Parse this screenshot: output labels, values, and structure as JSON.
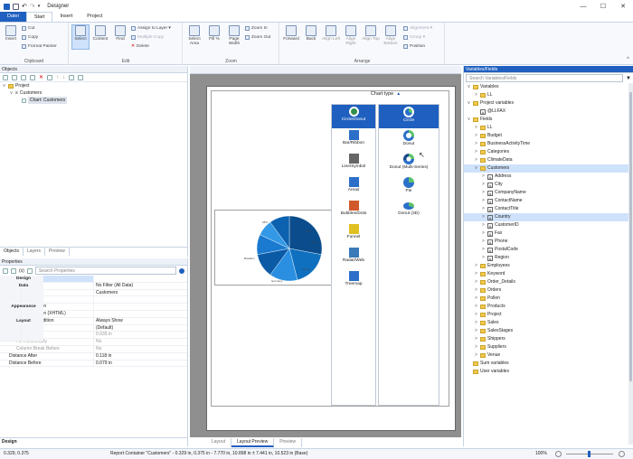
{
  "window": {
    "title": "Designer",
    "minimize": "—",
    "maximize": "☐",
    "close": "✕"
  },
  "tabs": [
    "Datei",
    "Start",
    "Insert",
    "Project"
  ],
  "ribbon": {
    "insert": "Insert",
    "cut": "Cut",
    "copy": "Copy",
    "format_painter": "Format Painter",
    "clipboard_label": "Clipboard",
    "select": "Select",
    "content": "Content",
    "find": "Find",
    "assign_to_layer": "Assign to Layer ▾",
    "multiple_copy": "Multiple Copy",
    "delete": "Delete",
    "edit_label": "Edit",
    "select_area": "Select Area",
    "fill": "Fill %",
    "page_width": "Page Width",
    "zoom_in": "Zoom In",
    "zoom_out": "Zoom Out",
    "zoom_label": "Zoom",
    "forward": "Forward",
    "back": "Back",
    "align_left": "Align Left",
    "align_right": "Align Right",
    "align_top": "Align Top",
    "align_bottom": "Align Bottom",
    "alignment": "Alignment ▾",
    "group": "Group ▾",
    "position": "Position",
    "arrange_label": "Arrange"
  },
  "objects": {
    "header": "Objects",
    "tree": [
      "Project",
      "Customers",
      "Chart: Customers"
    ],
    "tabs": [
      "Objects",
      "Layers",
      "Preview"
    ]
  },
  "properties": {
    "header": "Properties",
    "search_placeholder": "Search Properties",
    "rows": [
      {
        "n": "Design",
        "v": "",
        "k": "cat"
      },
      {
        "n": "Name",
        "v": "",
        "k": "sel"
      },
      {
        "n": "Data",
        "v": "",
        "k": "cat"
      },
      {
        "n": "Data Filter",
        "v": "No Filter (All Data)",
        "k": ""
      },
      {
        "n": "Data Source",
        "v": "Customers",
        "k": ""
      },
      {
        "n": "Sort Order",
        "v": "",
        "k": ""
      },
      {
        "n": "Appearance",
        "v": "",
        "k": "cat"
      },
      {
        "n": "Preview Animation",
        "v": "",
        "k": ""
      },
      {
        "n": "Preview Animation (XHTML)",
        "v": "",
        "k": ""
      },
      {
        "n": "Layout",
        "v": "",
        "k": "cat"
      },
      {
        "n": "Appearance Condition",
        "v": "Always Show",
        "k": ""
      },
      {
        "n": "Column Count",
        "v": "(Default)",
        "k": ""
      },
      {
        "n": "Distance",
        "v": "0.039 in",
        "k": "sub dim"
      },
      {
        "n": "Fill Horizontally",
        "v": "No",
        "k": "sub dim"
      },
      {
        "n": "Column Break Before",
        "v": "No",
        "k": "sub dim"
      },
      {
        "n": "Distance After",
        "v": "0.118 in",
        "k": ""
      },
      {
        "n": "Distance Before",
        "v": "0.079 in",
        "k": ""
      }
    ],
    "footer": "Design"
  },
  "designer": {
    "chart_type_label": "Chart type",
    "categories": [
      "Circle/Donut",
      "Bar/Ribbon",
      "Line/Symbol",
      "Areas",
      "Bubbles/Dots",
      "Funnel",
      "Radar/Web",
      "Treemap"
    ],
    "types": [
      "Circle",
      "Donut",
      "Donut (Multi-Series)",
      "Pie",
      "Donut (3D)"
    ],
    "bottom_tabs": [
      "Layout",
      "Layout Preview",
      "Preview"
    ]
  },
  "pie_labels": [
    "28%",
    "18%",
    "Brasilien",
    "Germany",
    "France",
    "USA"
  ],
  "chart_data": {
    "type": "pie",
    "values": [
      28,
      18,
      14,
      12,
      10,
      8,
      10
    ],
    "colors": [
      "#0a4c8c",
      "#1070c0",
      "#2a8fe0",
      "#0a5aa6",
      "#1a7ad0",
      "#3398e6",
      "#0d62b0"
    ]
  },
  "variables": {
    "header": "Variables/Fields",
    "search_placeholder": "Search Variables/Fields",
    "tree": [
      {
        "t": "Variables",
        "lvl": 0,
        "ic": "fold",
        "ch": "v"
      },
      {
        "t": "LL",
        "lvl": 1,
        "ic": "fold",
        "ch": ">"
      },
      {
        "t": "Project variables",
        "lvl": 0,
        "ic": "fold",
        "ch": "v"
      },
      {
        "t": "@LLFAX",
        "lvl": 1,
        "ic": "af",
        "ch": ""
      },
      {
        "t": "Fields",
        "lvl": 0,
        "ic": "fold",
        "ch": "v"
      },
      {
        "t": "LL",
        "lvl": 1,
        "ic": "fold",
        "ch": ">"
      },
      {
        "t": "Budget",
        "lvl": 1,
        "ic": "fold",
        "ch": ">"
      },
      {
        "t": "BusinessActivityTime",
        "lvl": 1,
        "ic": "fold",
        "ch": ">"
      },
      {
        "t": "Categories",
        "lvl": 1,
        "ic": "fold",
        "ch": ">"
      },
      {
        "t": "ClimateData",
        "lvl": 1,
        "ic": "fold",
        "ch": ">"
      },
      {
        "t": "Customers",
        "lvl": 1,
        "ic": "fold",
        "ch": "v",
        "sel": true
      },
      {
        "t": "Address",
        "lvl": 2,
        "ic": "af",
        "ch": ">"
      },
      {
        "t": "City",
        "lvl": 2,
        "ic": "af",
        "ch": ">"
      },
      {
        "t": "CompanyName",
        "lvl": 2,
        "ic": "af",
        "ch": ">"
      },
      {
        "t": "ContactName",
        "lvl": 2,
        "ic": "af",
        "ch": ">"
      },
      {
        "t": "ContactTitle",
        "lvl": 2,
        "ic": "af",
        "ch": ">"
      },
      {
        "t": "Country",
        "lvl": 2,
        "ic": "af",
        "ch": ">",
        "sel": true
      },
      {
        "t": "CustomerID",
        "lvl": 2,
        "ic": "af",
        "ch": ">"
      },
      {
        "t": "Fax",
        "lvl": 2,
        "ic": "af",
        "ch": ">"
      },
      {
        "t": "Phone",
        "lvl": 2,
        "ic": "af",
        "ch": ">"
      },
      {
        "t": "PostalCode",
        "lvl": 2,
        "ic": "af",
        "ch": ">"
      },
      {
        "t": "Region",
        "lvl": 2,
        "ic": "af",
        "ch": ">"
      },
      {
        "t": "Employees",
        "lvl": 1,
        "ic": "fold",
        "ch": ">"
      },
      {
        "t": "Keyword",
        "lvl": 1,
        "ic": "fold",
        "ch": ">"
      },
      {
        "t": "Order_Details",
        "lvl": 1,
        "ic": "fold",
        "ch": ">"
      },
      {
        "t": "Orders",
        "lvl": 1,
        "ic": "fold",
        "ch": ">"
      },
      {
        "t": "Pollen",
        "lvl": 1,
        "ic": "fold",
        "ch": ">"
      },
      {
        "t": "Products",
        "lvl": 1,
        "ic": "fold",
        "ch": ">"
      },
      {
        "t": "Project",
        "lvl": 1,
        "ic": "fold",
        "ch": ">"
      },
      {
        "t": "Sales",
        "lvl": 1,
        "ic": "fold",
        "ch": ">"
      },
      {
        "t": "SalesStages",
        "lvl": 1,
        "ic": "fold",
        "ch": ">"
      },
      {
        "t": "Shippers",
        "lvl": 1,
        "ic": "fold",
        "ch": ">"
      },
      {
        "t": "Suppliers",
        "lvl": 1,
        "ic": "fold",
        "ch": ">"
      },
      {
        "t": "Venue",
        "lvl": 1,
        "ic": "fold",
        "ch": ">"
      },
      {
        "t": "Sum variables",
        "lvl": 0,
        "ic": "fold",
        "ch": ""
      },
      {
        "t": "User variables",
        "lvl": 0,
        "ic": "fold",
        "ch": ""
      }
    ]
  },
  "status": {
    "coords": "0.329, 0.375",
    "info": "Report Container \"Customers\" - 0.329 in, 0.375 in - 7.770 in, 10.898 in  ±  7.441 in, 10.523 in (Base)",
    "zoom": "100%"
  }
}
